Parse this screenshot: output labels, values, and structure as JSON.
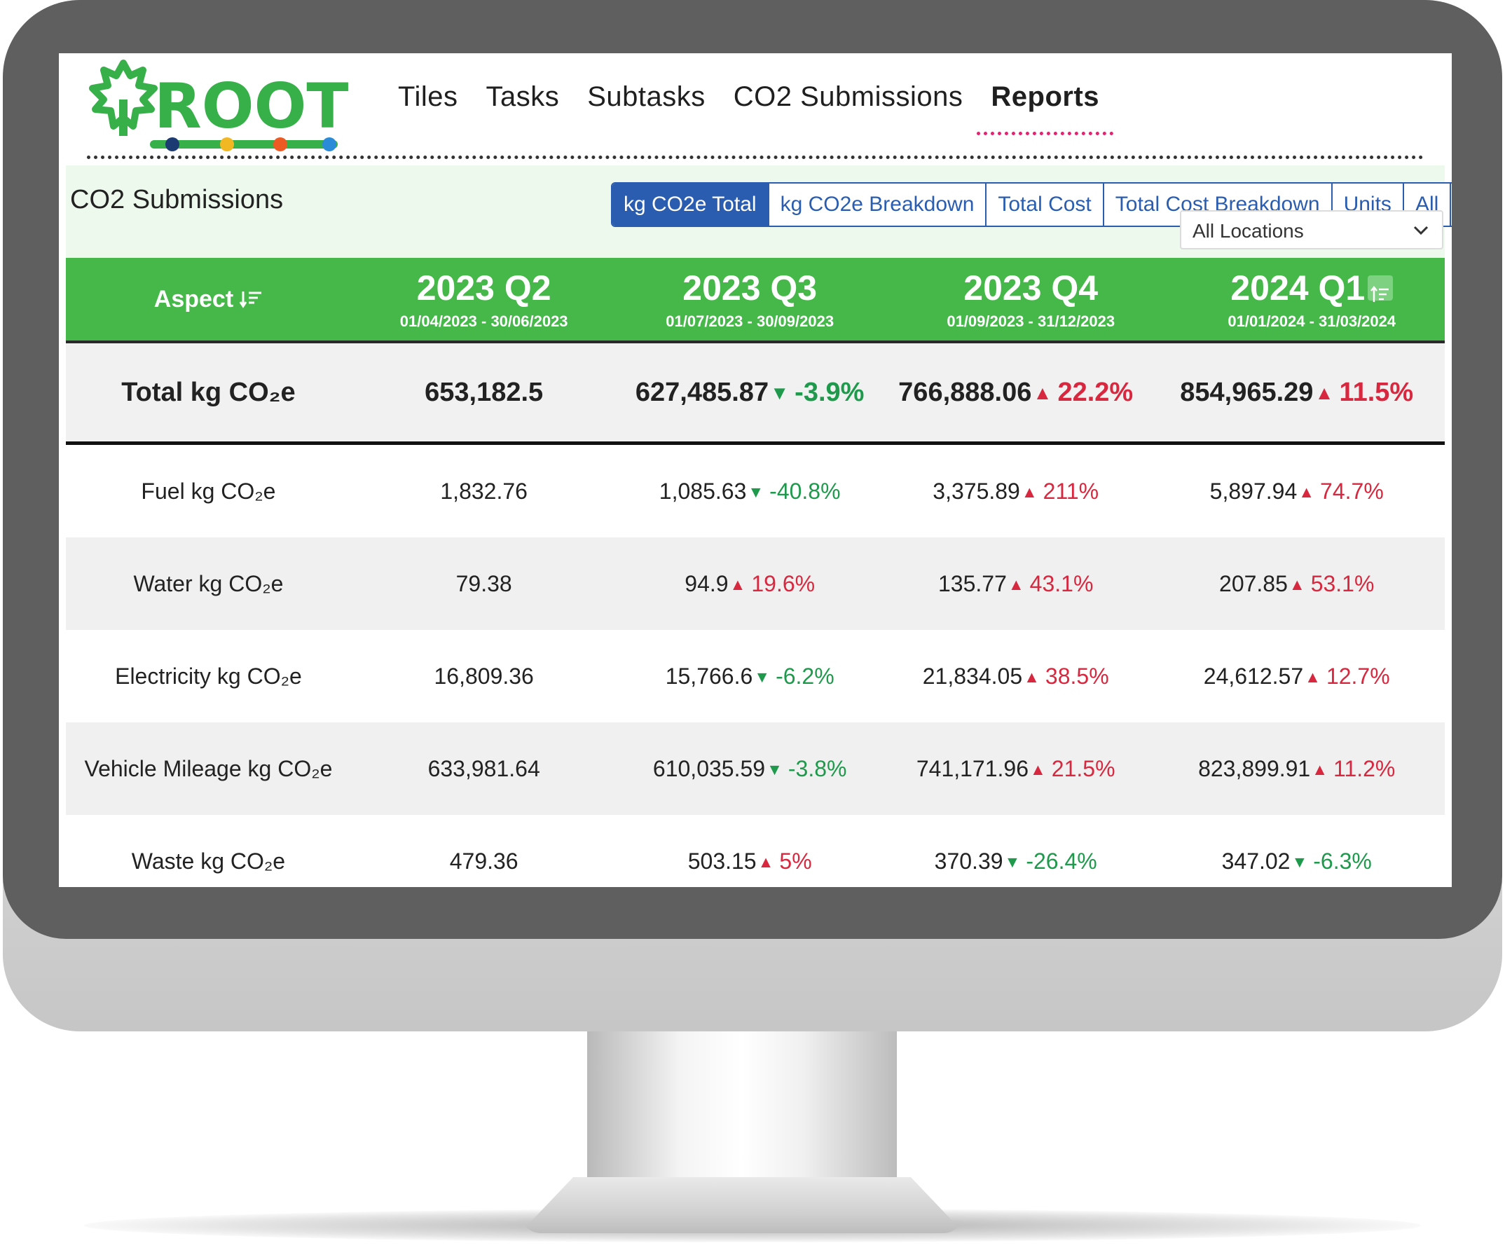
{
  "nav": {
    "logo_text": "ROOT",
    "items": [
      {
        "label": "Tiles"
      },
      {
        "label": "Tasks"
      },
      {
        "label": "Subtasks"
      },
      {
        "label": "CO2 Submissions"
      },
      {
        "label": "Reports",
        "active": true
      }
    ]
  },
  "panel": {
    "title": "CO2 Submissions",
    "tabs": [
      {
        "label": "kg CO2e Total",
        "active": true
      },
      {
        "label": "kg CO2e Breakdown"
      },
      {
        "label": "Total Cost"
      },
      {
        "label": "Total Cost Breakdown"
      },
      {
        "label": "Units"
      },
      {
        "label": "All"
      }
    ],
    "calculator_icon": "calculator-icon",
    "location_select": {
      "value": "All Locations"
    }
  },
  "table": {
    "aspect_header": "Aspect",
    "sort_icon": "sort-icon",
    "columns": [
      {
        "quarter": "2023 Q2",
        "range": "01/04/2023 - 30/06/2023"
      },
      {
        "quarter": "2023 Q3",
        "range": "01/07/2023 - 30/09/2023"
      },
      {
        "quarter": "2023 Q4",
        "range": "01/09/2023 - 31/12/2023"
      },
      {
        "quarter": "2024 Q1",
        "range": "01/01/2024 - 31/03/2024"
      }
    ],
    "rows": [
      {
        "label": "Total kg CO₂e",
        "total": true,
        "cells": [
          {
            "value": "653,182.5"
          },
          {
            "value": "627,485.87",
            "dir": "down",
            "change": "-3.9%"
          },
          {
            "value": "766,888.06",
            "dir": "up",
            "change": "22.2%"
          },
          {
            "value": "854,965.29",
            "dir": "up",
            "change": "11.5%"
          }
        ]
      },
      {
        "label": "Fuel kg CO₂e",
        "cells": [
          {
            "value": "1,832.76"
          },
          {
            "value": "1,085.63",
            "dir": "down",
            "change": "-40.8%"
          },
          {
            "value": "3,375.89",
            "dir": "up",
            "change": "211%"
          },
          {
            "value": "5,897.94",
            "dir": "up",
            "change": "74.7%"
          }
        ]
      },
      {
        "label": "Water kg CO₂e",
        "cells": [
          {
            "value": "79.38"
          },
          {
            "value": "94.9",
            "dir": "up",
            "change": "19.6%"
          },
          {
            "value": "135.77",
            "dir": "up",
            "change": "43.1%"
          },
          {
            "value": "207.85",
            "dir": "up",
            "change": "53.1%"
          }
        ]
      },
      {
        "label": "Electricity kg CO₂e",
        "cells": [
          {
            "value": "16,809.36"
          },
          {
            "value": "15,766.6",
            "dir": "down",
            "change": "-6.2%"
          },
          {
            "value": "21,834.05",
            "dir": "up",
            "change": "38.5%"
          },
          {
            "value": "24,612.57",
            "dir": "up",
            "change": "12.7%"
          }
        ]
      },
      {
        "label": "Vehicle Mileage kg CO₂e",
        "cells": [
          {
            "value": "633,981.64"
          },
          {
            "value": "610,035.59",
            "dir": "down",
            "change": "-3.8%"
          },
          {
            "value": "741,171.96",
            "dir": "up",
            "change": "21.5%"
          },
          {
            "value": "823,899.91",
            "dir": "up",
            "change": "11.2%"
          }
        ]
      },
      {
        "label": "Waste kg CO₂e",
        "cells": [
          {
            "value": "479.36"
          },
          {
            "value": "503.15",
            "dir": "up",
            "change": "5%"
          },
          {
            "value": "370.39",
            "dir": "down",
            "change": "-26.4%"
          },
          {
            "value": "347.02",
            "dir": "down",
            "change": "-6.3%"
          }
        ]
      }
    ]
  },
  "colors": {
    "brand_green": "#45b849",
    "tab_blue": "#2a5db0",
    "increase_red": "#d8283f",
    "decrease_green": "#1f9a4c",
    "nav_active_underline": "#e02470"
  }
}
